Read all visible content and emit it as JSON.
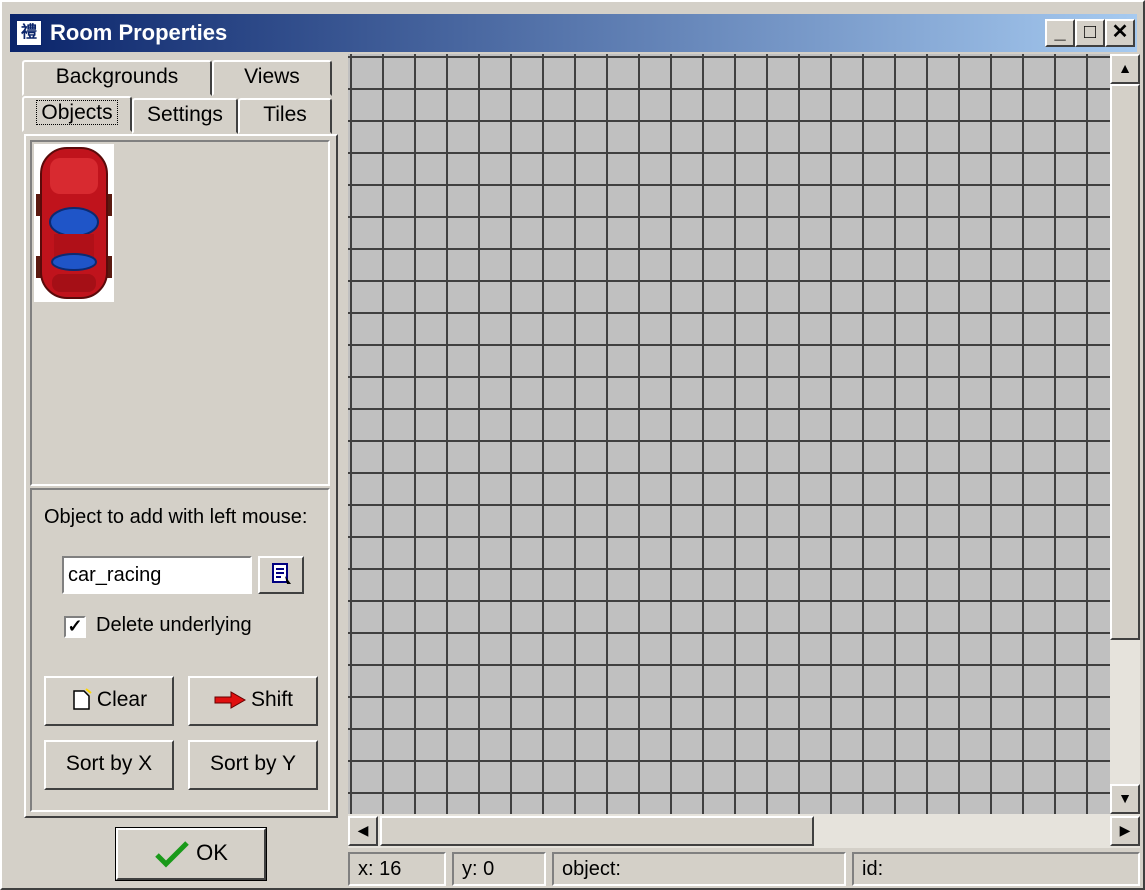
{
  "window": {
    "title": "Room Properties"
  },
  "tabs": {
    "backgrounds": "Backgrounds",
    "views": "Views",
    "objects": "Objects",
    "settings": "Settings",
    "tiles": "Tiles"
  },
  "objects_panel": {
    "object_label": "Object to add with left mouse:",
    "object_value": "car_racing",
    "delete_underlying_label": "Delete underlying",
    "delete_underlying_checked": true,
    "clear_label": "Clear",
    "shift_label": "Shift",
    "sort_x_label": "Sort by X",
    "sort_y_label": "Sort by Y"
  },
  "ok_label": "OK",
  "status": {
    "x": "x: 16",
    "y": "y: 0",
    "object": "object:",
    "id": "id:"
  },
  "colors": {
    "titlebar_start": "#0a246a",
    "titlebar_end": "#a6caf0",
    "grid": "#c0c0c0",
    "car": "#c0131c"
  }
}
